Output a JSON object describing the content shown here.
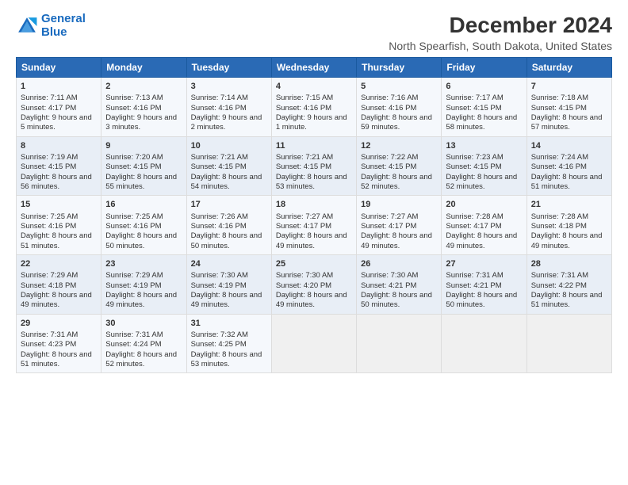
{
  "logo": {
    "line1": "General",
    "line2": "Blue"
  },
  "title": "December 2024",
  "subtitle": "North Spearfish, South Dakota, United States",
  "headers": [
    "Sunday",
    "Monday",
    "Tuesday",
    "Wednesday",
    "Thursday",
    "Friday",
    "Saturday"
  ],
  "weeks": [
    [
      {
        "day": "1",
        "sunrise": "7:11 AM",
        "sunset": "4:17 PM",
        "daylight": "9 hours and 5 minutes."
      },
      {
        "day": "2",
        "sunrise": "7:13 AM",
        "sunset": "4:16 PM",
        "daylight": "9 hours and 3 minutes."
      },
      {
        "day": "3",
        "sunrise": "7:14 AM",
        "sunset": "4:16 PM",
        "daylight": "9 hours and 2 minutes."
      },
      {
        "day": "4",
        "sunrise": "7:15 AM",
        "sunset": "4:16 PM",
        "daylight": "9 hours and 1 minute."
      },
      {
        "day": "5",
        "sunrise": "7:16 AM",
        "sunset": "4:16 PM",
        "daylight": "8 hours and 59 minutes."
      },
      {
        "day": "6",
        "sunrise": "7:17 AM",
        "sunset": "4:15 PM",
        "daylight": "8 hours and 58 minutes."
      },
      {
        "day": "7",
        "sunrise": "7:18 AM",
        "sunset": "4:15 PM",
        "daylight": "8 hours and 57 minutes."
      }
    ],
    [
      {
        "day": "8",
        "sunrise": "7:19 AM",
        "sunset": "4:15 PM",
        "daylight": "8 hours and 56 minutes."
      },
      {
        "day": "9",
        "sunrise": "7:20 AM",
        "sunset": "4:15 PM",
        "daylight": "8 hours and 55 minutes."
      },
      {
        "day": "10",
        "sunrise": "7:21 AM",
        "sunset": "4:15 PM",
        "daylight": "8 hours and 54 minutes."
      },
      {
        "day": "11",
        "sunrise": "7:21 AM",
        "sunset": "4:15 PM",
        "daylight": "8 hours and 53 minutes."
      },
      {
        "day": "12",
        "sunrise": "7:22 AM",
        "sunset": "4:15 PM",
        "daylight": "8 hours and 52 minutes."
      },
      {
        "day": "13",
        "sunrise": "7:23 AM",
        "sunset": "4:15 PM",
        "daylight": "8 hours and 52 minutes."
      },
      {
        "day": "14",
        "sunrise": "7:24 AM",
        "sunset": "4:16 PM",
        "daylight": "8 hours and 51 minutes."
      }
    ],
    [
      {
        "day": "15",
        "sunrise": "7:25 AM",
        "sunset": "4:16 PM",
        "daylight": "8 hours and 51 minutes."
      },
      {
        "day": "16",
        "sunrise": "7:25 AM",
        "sunset": "4:16 PM",
        "daylight": "8 hours and 50 minutes."
      },
      {
        "day": "17",
        "sunrise": "7:26 AM",
        "sunset": "4:16 PM",
        "daylight": "8 hours and 50 minutes."
      },
      {
        "day": "18",
        "sunrise": "7:27 AM",
        "sunset": "4:17 PM",
        "daylight": "8 hours and 49 minutes."
      },
      {
        "day": "19",
        "sunrise": "7:27 AM",
        "sunset": "4:17 PM",
        "daylight": "8 hours and 49 minutes."
      },
      {
        "day": "20",
        "sunrise": "7:28 AM",
        "sunset": "4:17 PM",
        "daylight": "8 hours and 49 minutes."
      },
      {
        "day": "21",
        "sunrise": "7:28 AM",
        "sunset": "4:18 PM",
        "daylight": "8 hours and 49 minutes."
      }
    ],
    [
      {
        "day": "22",
        "sunrise": "7:29 AM",
        "sunset": "4:18 PM",
        "daylight": "8 hours and 49 minutes."
      },
      {
        "day": "23",
        "sunrise": "7:29 AM",
        "sunset": "4:19 PM",
        "daylight": "8 hours and 49 minutes."
      },
      {
        "day": "24",
        "sunrise": "7:30 AM",
        "sunset": "4:19 PM",
        "daylight": "8 hours and 49 minutes."
      },
      {
        "day": "25",
        "sunrise": "7:30 AM",
        "sunset": "4:20 PM",
        "daylight": "8 hours and 49 minutes."
      },
      {
        "day": "26",
        "sunrise": "7:30 AM",
        "sunset": "4:21 PM",
        "daylight": "8 hours and 50 minutes."
      },
      {
        "day": "27",
        "sunrise": "7:31 AM",
        "sunset": "4:21 PM",
        "daylight": "8 hours and 50 minutes."
      },
      {
        "day": "28",
        "sunrise": "7:31 AM",
        "sunset": "4:22 PM",
        "daylight": "8 hours and 51 minutes."
      }
    ],
    [
      {
        "day": "29",
        "sunrise": "7:31 AM",
        "sunset": "4:23 PM",
        "daylight": "8 hours and 51 minutes."
      },
      {
        "day": "30",
        "sunrise": "7:31 AM",
        "sunset": "4:24 PM",
        "daylight": "8 hours and 52 minutes."
      },
      {
        "day": "31",
        "sunrise": "7:32 AM",
        "sunset": "4:25 PM",
        "daylight": "8 hours and 53 minutes."
      },
      null,
      null,
      null,
      null
    ]
  ]
}
